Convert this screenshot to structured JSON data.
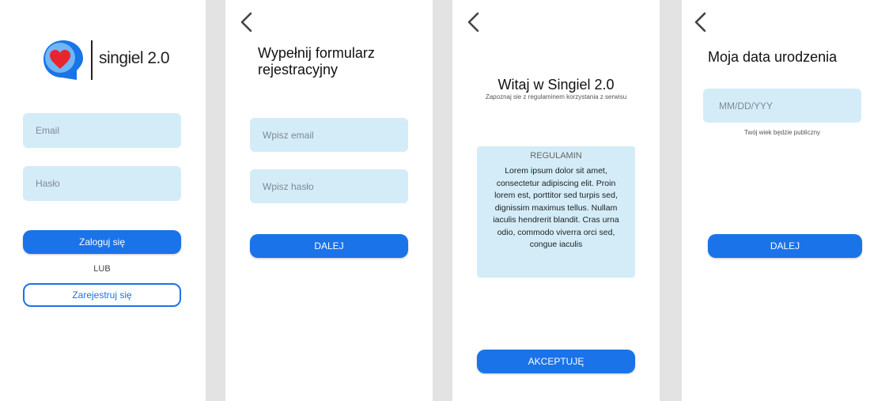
{
  "login": {
    "logo_text": "singiel 2.0",
    "email_placeholder": "Email",
    "password_placeholder": "Hasło",
    "login_button": "Zaloguj się",
    "or_text": "LUB",
    "register_button": "Zarejestruj się"
  },
  "register": {
    "title": "Wypełnij formularz rejestracyjny",
    "email_placeholder": "Wpisz email",
    "password_placeholder": "Wpisz hasło",
    "next_button": "DALEJ"
  },
  "terms": {
    "title": "Witaj w Singiel 2.0",
    "subtitle": "Zapoznaj sie z regulaminem korzystania z serwisu",
    "rules_heading": "REGULAMIN",
    "rules_text": "Lorem ipsum dolor sit amet, consectetur adipiscing elit. Proin lorem est, porttitor sed turpis sed, dignissim maximus tellus. Nullam iaculis hendrerit blandit. Cras urna odio, commodo viverra orci sed, congue iaculis",
    "accept_button": "AKCEPTUJĘ"
  },
  "birthdate": {
    "title": "Moja data urodzenia",
    "date_placeholder": "MM/DD/YYY",
    "note": "Twój wiek będzie publiczny",
    "next_button": "DALEJ"
  },
  "colors": {
    "accent": "#1a73e8",
    "field_bg": "#d3ecf8",
    "heart": "#e8252f",
    "divider_bg": "#e3e3e3"
  },
  "icons": [
    "back-arrow-icon",
    "heart-chat-logo-icon"
  ]
}
